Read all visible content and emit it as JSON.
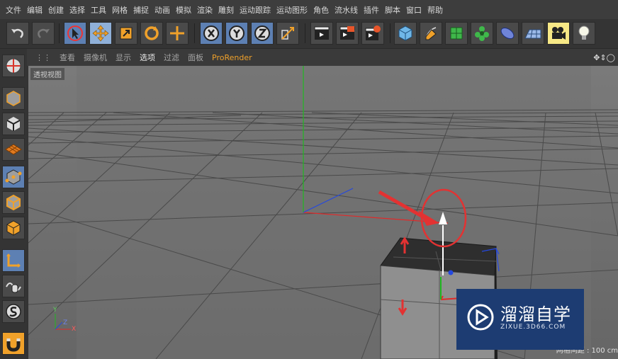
{
  "menubar": {
    "items": [
      "文件",
      "编辑",
      "创建",
      "选择",
      "工具",
      "网格",
      "捕捉",
      "动画",
      "模拟",
      "渲染",
      "雕刻",
      "运动跟踪",
      "运动图形",
      "角色",
      "流水线",
      "插件",
      "脚本",
      "窗口",
      "帮助"
    ]
  },
  "toolbar": {
    "groups": [
      "undo",
      "transform",
      "axis",
      "render",
      "objects"
    ],
    "icons": [
      "undo-icon",
      "redo-icon",
      "live-selection-icon",
      "move-icon",
      "scale-icon",
      "rotate-icon",
      "coordinate-icon",
      "x-axis-icon",
      "y-axis-icon",
      "z-axis-icon",
      "world-axis-icon",
      "render-view-icon",
      "render-picture-viewer-icon",
      "render-settings-icon",
      "cube-object-icon",
      "pen-spline-icon",
      "subdivision-icon",
      "cloner-icon",
      "deformer-icon",
      "floor-icon",
      "camera-icon",
      "light-icon"
    ]
  },
  "leftbar": {
    "icons": [
      "model-mode-icon",
      "object-mode-icon",
      "texture-mode-icon",
      "workplane-icon",
      "points-mode-icon",
      "edges-mode-icon",
      "polygons-mode-icon",
      "axis-mode-icon",
      "tweak-icon",
      "snap-icon",
      "magnet-icon"
    ]
  },
  "viewport_menu": {
    "items": [
      "查看",
      "摄像机",
      "显示",
      "选项",
      "过滤",
      "面板",
      "ProRender"
    ],
    "active_index": 3
  },
  "viewport": {
    "label": "透视视图",
    "grid_info": "网格间距 : 100 cm",
    "axis_labels": {
      "y": "Y",
      "z": "Z",
      "x": "X"
    },
    "colors": {
      "x_axis": "#e02a2a",
      "y_axis": "#21b821",
      "z_axis": "#2448e0",
      "highlight": "#e33232"
    }
  },
  "watermark": {
    "title": "溜溜自学",
    "subtitle": "ZIXUE.3D66.COM"
  }
}
